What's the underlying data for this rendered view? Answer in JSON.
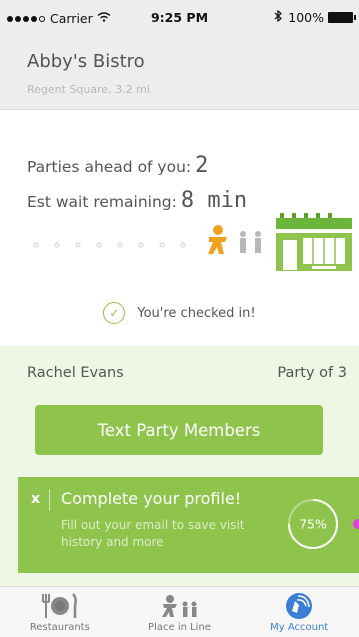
{
  "status_bar": {
    "carrier": "Carrier",
    "time": "9:25 PM",
    "battery": "100%"
  },
  "header": {
    "title": "Abby's Bistro",
    "subtitle": "Regent Square, 3.2 mi"
  },
  "queue": {
    "parties_label": "Parties ahead of you:",
    "parties_value": "2",
    "wait_label": "Est wait remaining:",
    "wait_value": "8 min"
  },
  "check_in": {
    "text": "You're checked in!"
  },
  "party": {
    "name": "Rachel Evans",
    "size_text": "Party of 3",
    "button_label": "Text Party Members"
  },
  "profile_prompt": {
    "dismiss_label": "x",
    "title": "Complete your profile!",
    "text": "Fill out your email to save visit history and more",
    "progress_label": "75%",
    "progress_fraction": 0.75
  },
  "tabs": [
    {
      "label": "Restaurants",
      "icon": "restaurants-icon",
      "active": false
    },
    {
      "label": "Place in Line",
      "icon": "place-in-line-icon",
      "active": false
    },
    {
      "label": "My Account",
      "icon": "my-account-icon",
      "active": true
    }
  ],
  "colors": {
    "accent_green": "#8ec34c",
    "light_green": "#eef6e4",
    "active_blue": "#3a7fd5",
    "user_orange": "#f0a21e",
    "header_gray": "#ededed"
  }
}
